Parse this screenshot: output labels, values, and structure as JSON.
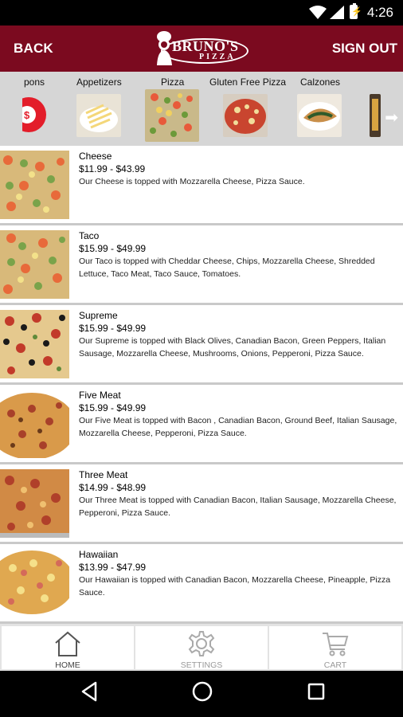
{
  "status": {
    "time": "4:26"
  },
  "header": {
    "back_label": "BACK",
    "signout_label": "SIGN OUT",
    "logo_name": "BRUNO'S",
    "logo_sub": "PIZZA"
  },
  "categories": [
    {
      "label": "pons"
    },
    {
      "label": "Appetizers"
    },
    {
      "label": "Pizza"
    },
    {
      "label": "Gluten Free Pizza"
    },
    {
      "label": "Calzones"
    }
  ],
  "items": [
    {
      "name": "Cheese",
      "price": "$11.99 - $43.99",
      "desc": "Our Cheese is topped with Mozzarella Cheese, Pizza Sauce."
    },
    {
      "name": "Taco",
      "price": "$15.99 - $49.99",
      "desc": "Our Taco  is topped with Cheddar Cheese, Chips, Mozzarella Cheese, Shredded Lettuce, Taco Meat, Taco Sauce, Tomatoes."
    },
    {
      "name": "Supreme",
      "price": "$15.99 - $49.99",
      "desc": "Our Supreme is topped with Black Olives, Canadian Bacon, Green Peppers, Italian Sausage, Mozzarella Cheese, Mushrooms, Onions, Pepperoni, Pizza Sauce."
    },
    {
      "name": "Five Meat",
      "price": "$15.99 - $49.99",
      "desc": "Our Five Meat is topped with Bacon , Canadian Bacon, Ground Beef, Italian Sausage, Mozzarella Cheese, Pepperoni, Pizza Sauce."
    },
    {
      "name": "Three Meat",
      "price": "$14.99 - $48.99",
      "desc": "Our Three Meat is topped with Canadian Bacon, Italian Sausage, Mozzarella Cheese, Pepperoni, Pizza Sauce."
    },
    {
      "name": "Hawaiian",
      "price": "$13.99 - $47.99",
      "desc": "Our Hawaiian  is topped with Canadian Bacon, Mozzarella Cheese, Pineapple, Pizza Sauce."
    }
  ],
  "tabs": [
    {
      "label": "HOME",
      "icon": "home-icon"
    },
    {
      "label": "SETTINGS",
      "icon": "gear-icon"
    },
    {
      "label": "CART",
      "icon": "cart-icon"
    }
  ],
  "colors": {
    "brand": "#7b0a1f",
    "category_bar": "#d6d6d6"
  }
}
